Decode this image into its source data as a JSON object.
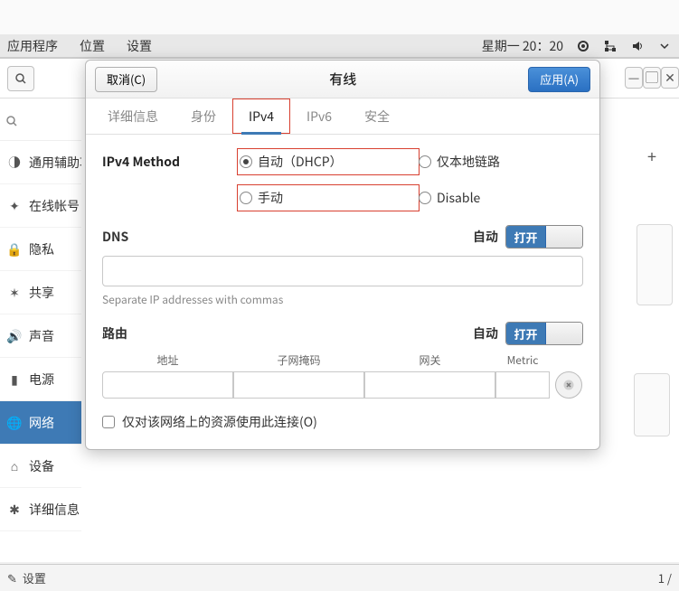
{
  "topbar": {
    "menu": [
      "应用程序",
      "位置",
      "设置"
    ],
    "datetime": "星期一 20：20"
  },
  "sidebar": {
    "items": [
      {
        "label": "通用辅助功"
      },
      {
        "label": "在线帐号"
      },
      {
        "label": "隐私"
      },
      {
        "label": "共享"
      },
      {
        "label": "声音"
      },
      {
        "label": "电源"
      },
      {
        "label": "网络"
      },
      {
        "label": "设备"
      },
      {
        "label": "详细信息"
      }
    ]
  },
  "dialog": {
    "cancel": "取消(C)",
    "title": "有线",
    "apply": "应用(A)",
    "tabs": {
      "details": "详细信息",
      "identity": "身份",
      "ipv4": "IPv4",
      "ipv6": "IPv6",
      "security": "安全"
    },
    "method_label": "IPv4 Method",
    "methods": {
      "auto": "自动（DHCP）",
      "link_local": "仅本地链路",
      "manual": "手动",
      "disable": "Disable"
    },
    "dns": {
      "title": "DNS",
      "auto": "自动",
      "toggle": "打开",
      "hint": "Separate IP addresses with commas"
    },
    "routes": {
      "title": "路由",
      "auto": "自动",
      "toggle": "打开",
      "headers": {
        "addr": "地址",
        "mask": "子网掩码",
        "gw": "网关",
        "metric": "Metric"
      }
    },
    "only_resources": "仅对该网络上的资源使用此连接(O)"
  },
  "bottombar": {
    "label": "设置",
    "page": "1 /"
  }
}
